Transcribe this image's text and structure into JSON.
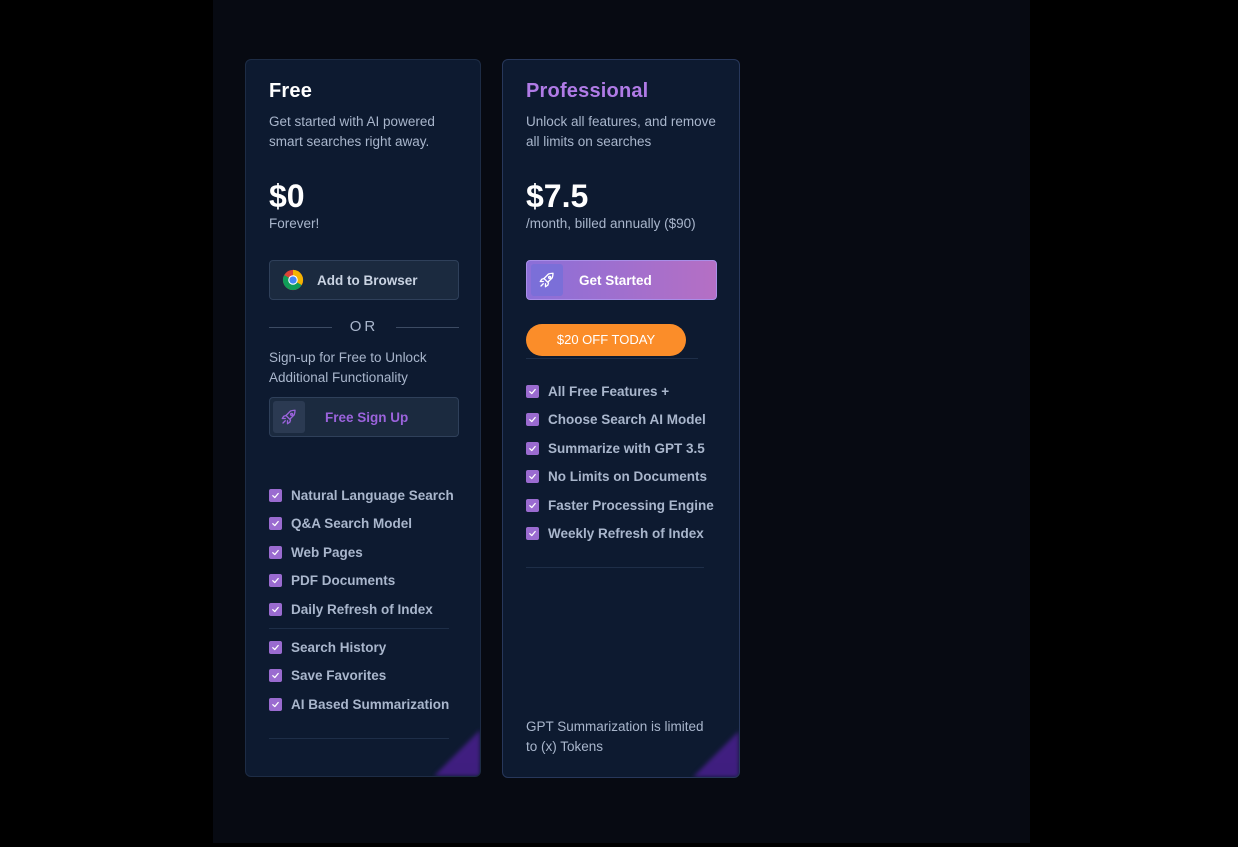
{
  "free": {
    "title": "Free",
    "description": "Get started with AI powered smart searches right away.",
    "price": "$0",
    "price_sub": "Forever!",
    "browser_button": "Add to Browser",
    "or_label": "OR",
    "signup_description": "Sign-up for Free to Unlock Additional Functionality",
    "signup_button": "Free Sign Up",
    "features_group1": [
      "Natural Language Search",
      "Q&A Search Model",
      "Web Pages",
      "PDF Documents",
      "Daily Refresh of Index"
    ],
    "features_group2": [
      "Search History",
      "Save Favorites",
      "AI Based Summarization"
    ]
  },
  "pro": {
    "title": "Professional",
    "description": "Unlock all features, and remove all limits on searches",
    "price": "$7.5",
    "price_sub": "/month, billed annually ($90)",
    "start_button": "Get Started",
    "promo_badge": "$20 OFF TODAY",
    "features": [
      "All Free Features +",
      "Choose Search AI Model",
      "Summarize with GPT 3.5",
      "No Limits on Documents",
      "Faster Processing Engine",
      "Weekly Refresh of Index"
    ],
    "footnote": "GPT Summarization is limited to (x) Tokens"
  },
  "colors": {
    "accent_purple": "#b07be6",
    "promo_orange": "#fb8d29",
    "card_bg": "#0d1a30"
  },
  "icons": [
    "chrome-icon",
    "rocket-icon",
    "check-icon"
  ]
}
